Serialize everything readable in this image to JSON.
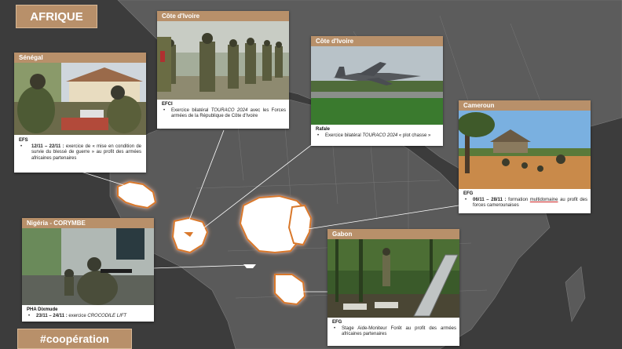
{
  "title": "AFRIQUE",
  "hashtag": "#coopération",
  "cards": {
    "senegal": {
      "header": "Sénégal",
      "unit": "EFS",
      "dates": "12/11 – 22/11 :",
      "text": "exercice de « mise en condition de survie du blessé de guerre » au profit des armées africaines partenaires"
    },
    "cote_ivoire_1": {
      "header": "Côte d'Ivoire",
      "unit": "EFCI",
      "text_pre": "Exercice bilatéral ",
      "text_italic": "TOURACO 2024",
      "text_post": " avec les Forces armées de la République de Côte d'Ivoire"
    },
    "cote_ivoire_2": {
      "header": "Côte d'Ivoire",
      "unit": "Rafale",
      "text_pre": "Exercice bilatéral ",
      "text_italic": "TOURACO 2024",
      "text_post": " « plot chasse »"
    },
    "cameroun": {
      "header": "Cameroun",
      "unit": "EFG",
      "dates": "06/11 – 28/11 :",
      "text_pre": " formation ",
      "text_underlined": "multidomaine",
      "text_post": " au profit des forces camerounaises"
    },
    "nigeria": {
      "header": "Nigéria - CORYMBE",
      "unit": "PHA Dixmude",
      "dates": "23/11 – 24/11 :",
      "text_pre": " exercice ",
      "text_italic": "CROCODILE LIFT"
    },
    "gabon": {
      "header": "Gabon",
      "unit": "EFG",
      "text": "Stage Aide-Moniteur Forêt au profit des armées africaines partenaires"
    }
  },
  "colors": {
    "accent": "#b8906a",
    "background": "#3f3f3f",
    "highlight_country": "#ffffff",
    "country_glow": "#d9782b"
  }
}
